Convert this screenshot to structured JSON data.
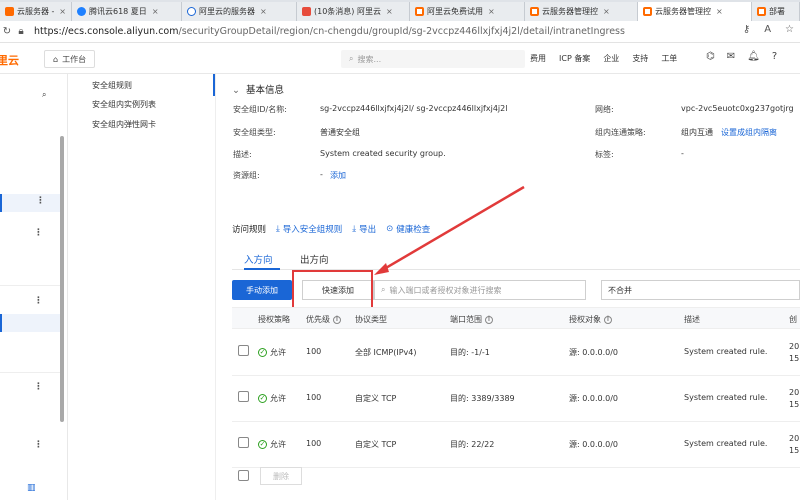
{
  "browser": {
    "tabs": [
      {
        "title": "云服务器 - 控",
        "active": false,
        "color": "#ff6a00"
      },
      {
        "title": "腾讯云618 夏日",
        "active": false,
        "color": "#1e80ff"
      },
      {
        "title": "阿里云的服务器",
        "active": false,
        "color": "#1a66d6"
      },
      {
        "title": "(10条消息) 阿里云",
        "active": false,
        "color": "#e74c3c"
      },
      {
        "title": "阿里云免费试用",
        "active": false,
        "color": "#ff6a00"
      },
      {
        "title": "云服务器管理控",
        "active": false,
        "color": "#ff6a00"
      },
      {
        "title": "云服务器管理控",
        "active": true,
        "color": "#ff6a00"
      },
      {
        "title": "部署",
        "active": false,
        "color": "#ff6a00"
      }
    ],
    "url_host": "https://ecs.console.aliyun.com",
    "url_path": "/securityGroupDetail/region/cn-chengdu/groupId/sg-2vccpz446llxjfxj4j2l/detail/intranetIngress"
  },
  "topnav": {
    "brand": "阿里云",
    "workbench": "工作台",
    "search_placeholder": "搜索...",
    "links": [
      "费用",
      "ICP 备案",
      "企业",
      "支持",
      "工单"
    ]
  },
  "submenu": {
    "items": [
      "安全组规则",
      "安全组内实例列表",
      "安全组内弹性网卡"
    ]
  },
  "basic_info": {
    "title": "基本信息",
    "fields": {
      "id_label": "安全组ID/名称:",
      "id_value": "sg-2vccpz446llxjfxj4j2l/ sg-2vccpz446llxjfxj4j2l",
      "type_label": "安全组类型:",
      "type_value": "普通安全组",
      "desc_label": "描述:",
      "desc_value": "System created security group.",
      "rg_label": "资源组:",
      "rg_dash": "-",
      "rg_add": "添加",
      "net_label": "网络:",
      "net_value": "vpc-2vc5euotc0xg237gotjrg",
      "intra_label": "组内连通策略:",
      "intra_value": "组内互通",
      "intra_link": "设置成组内隔离",
      "tag_label": "标签:",
      "tag_value": "-"
    }
  },
  "rules": {
    "title": "访问规则",
    "actions": [
      "导入安全组规则",
      "导出",
      "健康检查"
    ],
    "tabs": [
      "入方向",
      "出方向"
    ],
    "btn_manual": "手动添加",
    "btn_quick": "快速添加",
    "filter_placeholder": "输入端口或者授权对象进行搜索",
    "select_value": "不合并",
    "columns": [
      "授权策略",
      "优先级",
      "协议类型",
      "端口范围",
      "授权对象",
      "描述",
      "创"
    ],
    "rows": [
      {
        "policy": "允许",
        "priority": "100",
        "protocol": "全部 ICMP(IPv4)",
        "port": "目的: -1/-1",
        "source": "源: 0.0.0.0/0",
        "desc": "System created rule.",
        "time1": "20",
        "time2": "15"
      },
      {
        "policy": "允许",
        "priority": "100",
        "protocol": "自定义 TCP",
        "port": "目的: 3389/3389",
        "source": "源: 0.0.0.0/0",
        "desc": "System created rule.",
        "time1": "20",
        "time2": "15"
      },
      {
        "policy": "允许",
        "priority": "100",
        "protocol": "自定义 TCP",
        "port": "目的: 22/22",
        "source": "源: 0.0.0.0/0",
        "desc": "System created rule.",
        "time1": "20",
        "time2": "15"
      }
    ],
    "btn_delete": "删除"
  },
  "colors": {
    "primary": "#1a66d6",
    "brand": "#ff6a00",
    "annotation": "#e13a3a",
    "allow": "#2ea121"
  }
}
